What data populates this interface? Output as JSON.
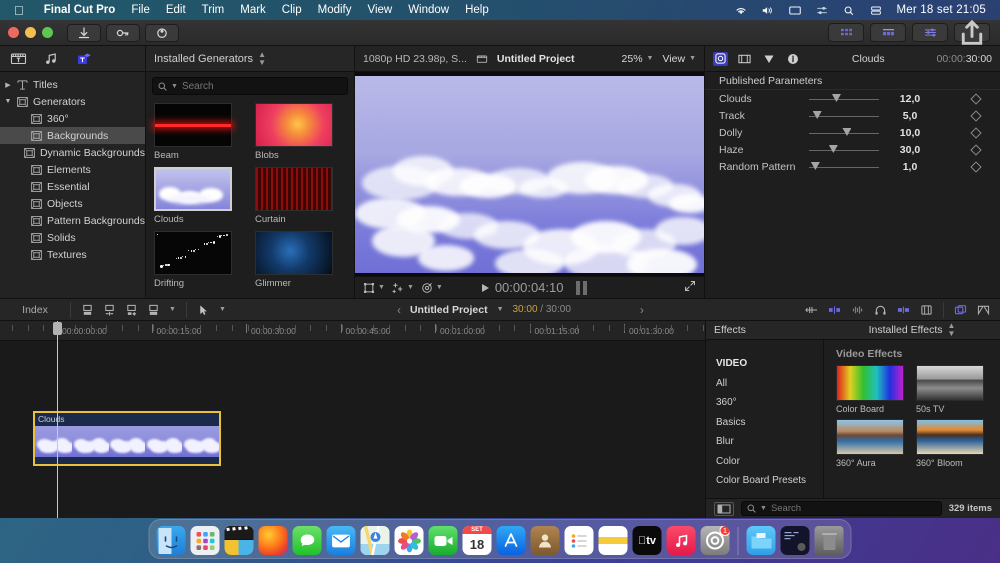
{
  "menubar": {
    "apple_icon": "apple-logo",
    "app_name": "Final Cut Pro",
    "items": [
      "File",
      "Edit",
      "Trim",
      "Mark",
      "Clip",
      "Modify",
      "View",
      "Window",
      "Help"
    ],
    "status_icons": [
      "wifi-icon",
      "volume-icon",
      "display-icon",
      "control-center-icon",
      "search-icon",
      "siri-icon"
    ],
    "clock": "Mer 18 set 21:05"
  },
  "toolbar": {
    "buttons": [
      "import-media-button",
      "keyword-button",
      "record-voiceover-button"
    ],
    "right_buttons": [
      "browser-toggle-button",
      "timeline-toggle-button",
      "inspector-toggle-button",
      "share-button"
    ]
  },
  "sidebar": {
    "tabs": [
      "titles-generators-tab",
      "music-sound-tab",
      "text-generators-tab"
    ],
    "items": [
      {
        "label": "Titles",
        "level": 1,
        "disclosure": "collapsed",
        "selected": false
      },
      {
        "label": "Generators",
        "level": 1,
        "disclosure": "expanded",
        "selected": false
      },
      {
        "label": "360°",
        "level": 2,
        "disclosure": "",
        "selected": false
      },
      {
        "label": "Backgrounds",
        "level": 2,
        "disclosure": "",
        "selected": true
      },
      {
        "label": "Dynamic Backgrounds",
        "level": 2,
        "disclosure": "",
        "selected": false
      },
      {
        "label": "Elements",
        "level": 2,
        "disclosure": "",
        "selected": false
      },
      {
        "label": "Essential",
        "level": 2,
        "disclosure": "",
        "selected": false
      },
      {
        "label": "Objects",
        "level": 2,
        "disclosure": "",
        "selected": false
      },
      {
        "label": "Pattern Backgrounds",
        "level": 2,
        "disclosure": "",
        "selected": false
      },
      {
        "label": "Solids",
        "level": 2,
        "disclosure": "",
        "selected": false
      },
      {
        "label": "Textures",
        "level": 2,
        "disclosure": "",
        "selected": false
      }
    ]
  },
  "browser": {
    "title": "Installed Generators",
    "sort_icon": "sort-chevrons-icon",
    "search_placeholder": "Search",
    "search_value": "",
    "search_icon": "search-icon",
    "generators": [
      {
        "name": "Beam",
        "selected": false
      },
      {
        "name": "Blobs",
        "selected": false
      },
      {
        "name": "Clouds",
        "selected": true
      },
      {
        "name": "Curtain",
        "selected": false
      },
      {
        "name": "Drifting",
        "selected": false
      },
      {
        "name": "Glimmer",
        "selected": false
      }
    ]
  },
  "viewer": {
    "format": "1080p HD 23.98p, S...",
    "project_icon": "project-icon",
    "project_name": "Untitled Project",
    "zoom": "25%",
    "view_label": "View",
    "timecode": "00:00:04:10",
    "control_icons": [
      "transform-icon",
      "enhance-icon",
      "color-balance-icon"
    ],
    "play_icon": "play-icon",
    "pause_icon": "pause-icon",
    "expand_icon": "fullscreen-icon"
  },
  "inspector": {
    "tabs": [
      "generator-inspector-tab",
      "video-inspector-tab",
      "color-inspector-tab",
      "info-inspector-tab"
    ],
    "title": "Clouds",
    "duration_dim": "00:00:",
    "duration_bright": "30:00",
    "section_title": "Published Parameters",
    "params": [
      {
        "name": "Clouds",
        "value": "12,0",
        "slider_pct": 37
      },
      {
        "name": "Track",
        "value": "5,0",
        "slider_pct": 6
      },
      {
        "name": "Dolly",
        "value": "10,0",
        "slider_pct": 54
      },
      {
        "name": "Haze",
        "value": "30,0",
        "slider_pct": 32
      },
      {
        "name": "Random Pattern",
        "value": "1,0",
        "slider_pct": 3
      }
    ],
    "keyframe_icon": "keyframe-diamond-icon"
  },
  "timeline_bar": {
    "index_label": "Index",
    "left_icons": [
      "append-icon",
      "insert-icon",
      "connect-icon",
      "overwrite-icon"
    ],
    "tool_icon": "select-tool-icon",
    "prev_icon": "previous-icon",
    "next_icon": "next-icon",
    "project_name": "Untitled Project",
    "position": "30:00",
    "duration": "30:00",
    "right_icons": [
      "skimming-icon",
      "audio-skimming-icon",
      "solo-icon",
      "snapping-icon",
      "clip-appearance-icon",
      "timeline-index-icon",
      "effects-browser-icon",
      "transitions-browser-icon"
    ]
  },
  "timeline": {
    "ruler_labels": [
      "00:00:00:00",
      "00:00:15:00",
      "00:00:30:00",
      "00:00:45:00",
      "00:01:00:00",
      "00:01:15:00",
      "00:01:30:00"
    ],
    "playhead_position": "00:00:00:00",
    "clips": [
      {
        "name": "Clouds",
        "selected": true
      }
    ]
  },
  "effects": {
    "header_left": "Effects",
    "header_right": "Installed Effects",
    "sort_icon": "sort-chevrons-icon",
    "categories": [
      "VIDEO",
      "All",
      "360°",
      "Basics",
      "Blur",
      "Color",
      "Color Board Presets"
    ],
    "grid_title": "Video Effects",
    "items": [
      {
        "name": "Color Board",
        "thumb": "color-spectrum"
      },
      {
        "name": "50s TV",
        "thumb": "bw-landscape"
      },
      {
        "name": "360° Aura",
        "thumb": "warm-landscape"
      },
      {
        "name": "360° Bloom",
        "thumb": "bloom-landscape"
      }
    ],
    "sidebar_toggle_icon": "sidebar-toggle-icon",
    "search_icon": "search-icon",
    "search_placeholder": "Search",
    "search_value": "",
    "item_count": "329 items"
  },
  "dock": {
    "items": [
      {
        "name": "finder",
        "glyph": "🙂",
        "running": true
      },
      {
        "name": "launchpad",
        "glyph": "",
        "running": false
      },
      {
        "name": "final-cut-pro",
        "glyph": "",
        "running": true
      },
      {
        "name": "firefox",
        "glyph": "",
        "running": false
      },
      {
        "name": "messages",
        "glyph": "",
        "running": false
      },
      {
        "name": "mail",
        "glyph": "✉",
        "running": false
      },
      {
        "name": "maps",
        "glyph": "",
        "running": false
      },
      {
        "name": "photos",
        "glyph": "",
        "running": false
      },
      {
        "name": "facetime",
        "glyph": "",
        "running": false
      },
      {
        "name": "calendar",
        "glyph": "18",
        "running": false
      },
      {
        "name": "app-store",
        "glyph": "A",
        "running": false
      },
      {
        "name": "contacts",
        "glyph": "",
        "running": false
      },
      {
        "name": "reminders",
        "glyph": "",
        "running": false
      },
      {
        "name": "notes",
        "glyph": "",
        "running": false
      },
      {
        "name": "apple-tv",
        "glyph": "tv",
        "running": false
      },
      {
        "name": "music",
        "glyph": "♫",
        "running": false
      },
      {
        "name": "system-settings",
        "glyph": "",
        "running": true,
        "badge": "1"
      }
    ],
    "extras": [
      {
        "name": "downloads-folder"
      },
      {
        "name": "terminal-window"
      },
      {
        "name": "trash"
      }
    ],
    "calendar_month": "SET",
    "calendar_day": "18"
  }
}
